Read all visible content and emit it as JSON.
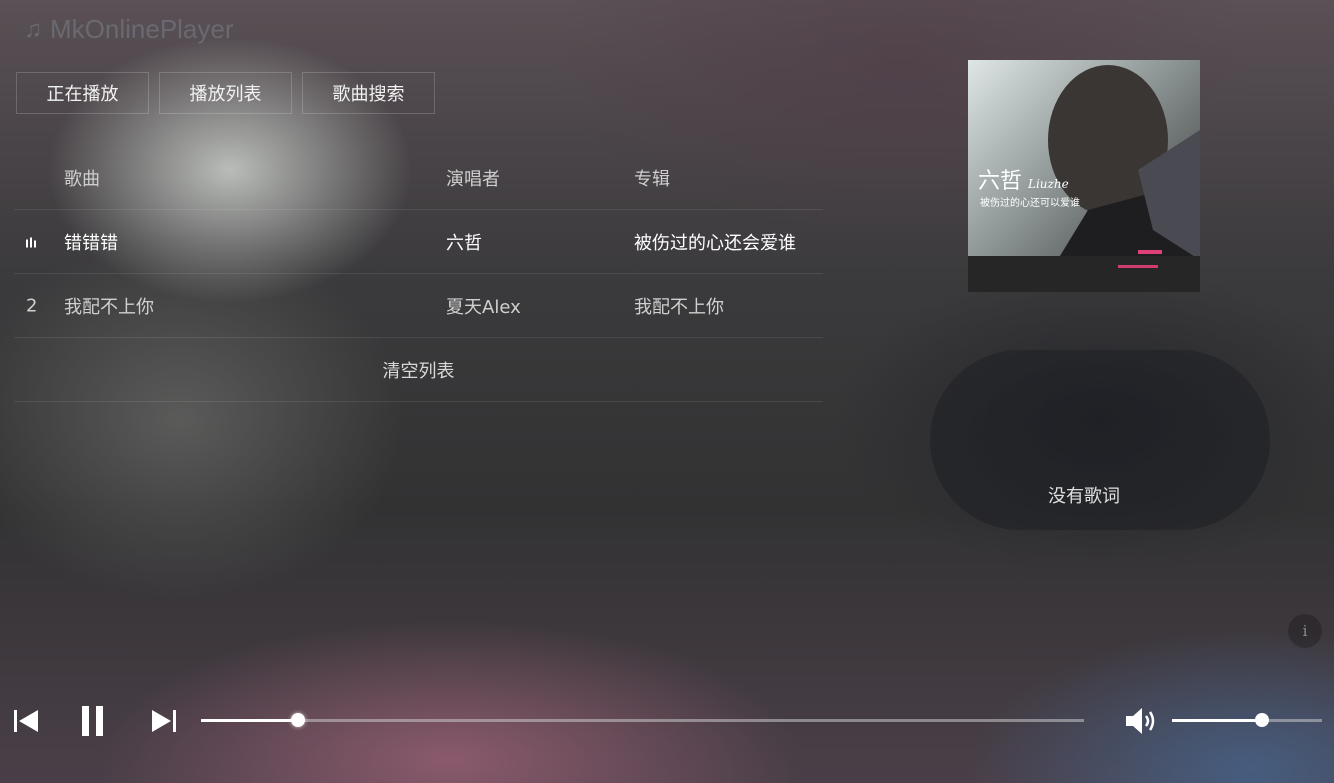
{
  "app": {
    "title": "MkOnlinePlayer"
  },
  "tabs": [
    {
      "label": "正在播放"
    },
    {
      "label": "播放列表"
    },
    {
      "label": "歌曲搜索"
    }
  ],
  "playlist": {
    "headers": {
      "song": "歌曲",
      "artist": "演唱者",
      "album": "专辑"
    },
    "rows": [
      {
        "num": "",
        "song": "错错错",
        "artist": "六哲",
        "album": "被伤过的心还会爱谁",
        "playing": true
      },
      {
        "num": "2",
        "song": "我配不上你",
        "artist": "夏天Alex",
        "album": "我配不上你",
        "playing": false
      }
    ],
    "clear_label": "清空列表"
  },
  "cover": {
    "artist_text": "六哲",
    "artist_latin": "Liuzhe",
    "album_text": "被伤过的心还可以爱谁"
  },
  "lyrics": {
    "empty_text": "没有歌词"
  },
  "info": {
    "glyph": "i"
  },
  "player": {
    "progress": 0.11,
    "volume": 0.6
  },
  "colors": {
    "accent": "#ffffff",
    "pink": "#e0407a"
  }
}
